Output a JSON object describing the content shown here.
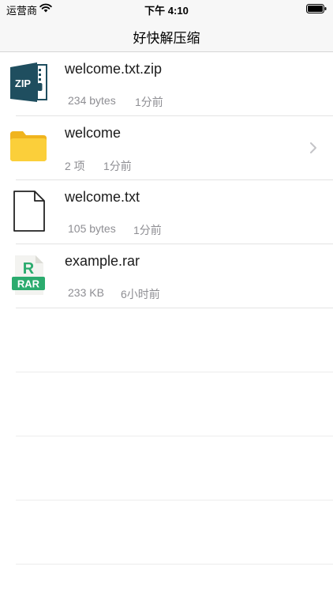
{
  "status_bar": {
    "carrier": "运营商",
    "time": "下午 4:10"
  },
  "nav": {
    "title": "好快解压缩"
  },
  "files": [
    {
      "name": "welcome.txt.zip",
      "size": "234 bytes",
      "modified": "1分前",
      "icon": "zip-file-icon"
    },
    {
      "name": "welcome",
      "size": "2 项",
      "modified": "1分前",
      "icon": "folder-icon",
      "has_disclosure": true
    },
    {
      "name": "welcome.txt",
      "size": "105 bytes",
      "modified": "1分前",
      "icon": "text-file-icon"
    },
    {
      "name": "example.rar",
      "size": "233 KB",
      "modified": "6小时前",
      "icon": "rar-file-icon"
    }
  ],
  "icon_labels": {
    "zip": "ZIP",
    "rar_letter": "R",
    "rar": "RAR"
  },
  "colors": {
    "zip_icon": "#1f4e5f",
    "folder_icon": "#f9c632",
    "rar_badge": "#2bab6e",
    "meta_text": "#8e8e93"
  }
}
